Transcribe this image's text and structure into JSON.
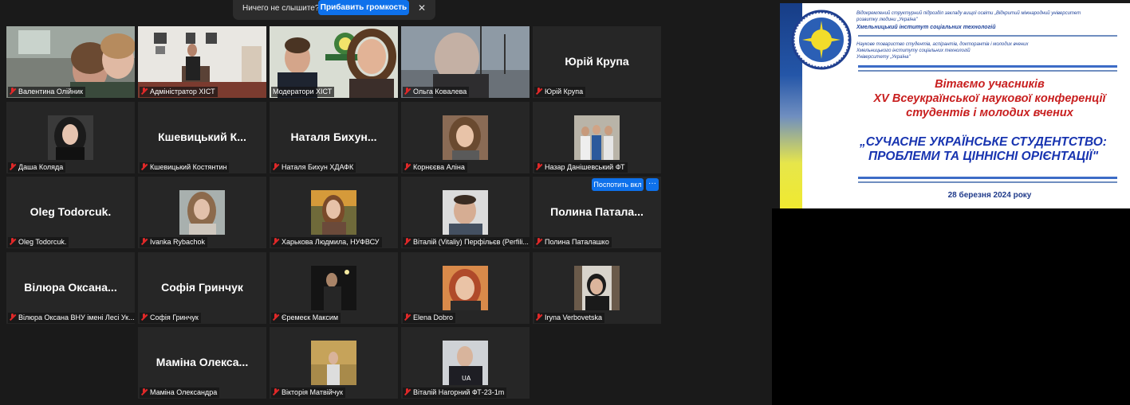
{
  "notification": {
    "text": "Ничего не слышите?",
    "button": "Прибавить громкость",
    "close": "✕"
  },
  "grid": {
    "spotlight_button": "Поспотить вкл",
    "more_button": "···"
  },
  "participants": [
    {
      "name": "Валентина Олійник",
      "display": "",
      "muted": true
    },
    {
      "name": "Адміністратор ХІСТ",
      "display": "",
      "muted": true
    },
    {
      "name": "Модератори ХІСТ",
      "display": "",
      "muted": false,
      "active": true
    },
    {
      "name": "Ольга Ковалева",
      "display": "",
      "muted": true
    },
    {
      "name": "Юрій Крупа",
      "display": "Юрій Крупа",
      "muted": true
    },
    {
      "name": "Даша Коляда",
      "display": "",
      "muted": true
    },
    {
      "name": "Кшевицький Костянтин",
      "display": "Кшевицький К...",
      "muted": true
    },
    {
      "name": "Наталя Бихун ХДАФК",
      "display": "Наталя Бихун...",
      "muted": true
    },
    {
      "name": "Корнєєва Аліна",
      "display": "",
      "muted": true
    },
    {
      "name": "Назар Данішевський ФТ",
      "display": "",
      "muted": true
    },
    {
      "name": "Oleg Todorcuk.",
      "display": "Oleg Todorcuk.",
      "muted": true
    },
    {
      "name": "Ivanka Rybachok",
      "display": "",
      "muted": true
    },
    {
      "name": "Харькова Людмила, НУФВСУ",
      "display": "",
      "muted": true
    },
    {
      "name": "Віталій (Vitaliy) Перфільєв (Perfili...",
      "display": "",
      "muted": true
    },
    {
      "name": "Полина Паталашко",
      "display": "Полина Патала...",
      "muted": true
    },
    {
      "name": "Вілюра Оксана ВНУ імені Лесі Ук...",
      "display": "Вілюра Оксана...",
      "muted": true
    },
    {
      "name": "Софія Гринчук",
      "display": "Софія Гринчук",
      "muted": true
    },
    {
      "name": "Єремеєк Максим",
      "display": "",
      "muted": true
    },
    {
      "name": "Elena Dobro",
      "display": "",
      "muted": true
    },
    {
      "name": "Iryna Verbovetska",
      "display": "",
      "muted": true
    },
    {
      "name": "Маміна Олександра",
      "display": "Маміна Олекса...",
      "muted": true
    },
    {
      "name": "Вікторія Матвійчук",
      "display": "",
      "muted": true
    },
    {
      "name": "Віталій Нагорний ФТ-23-1m",
      "display": "",
      "muted": true
    }
  ],
  "slide": {
    "header_1": "Відокремлений структурний підрозділ закладу вищої освіти „Відкритий міжнародний університет",
    "header_2": "розвитку людини „Україна\"",
    "header_3": "Хмельницький інститут соціальних технологій",
    "header_4": "Наукове товариство студентів, аспірантів, докторантів і молодих вчених",
    "header_5": "Хмельницького інституту соціальних технологій",
    "header_6": "Університету „Україна\"",
    "greeting_1": "Вітаємо учасників",
    "greeting_2": "XV Всеукраїнської наукової конференції",
    "greeting_3": "студентів і молодих вчених",
    "theme_1": "„СУЧАСНЕ УКРАЇНСЬКЕ СТУДЕНТСТВО:",
    "theme_2": "ПРОБЛЕМИ ТА ЦІННІСНІ ОРІЄНТАЦІЇ\"",
    "date": "28 березня 2024 року"
  },
  "colors": {
    "zoom_blue": "#0e71eb",
    "active_speaker": "#d8e05a",
    "muted_red": "#e02828",
    "slide_red": "#c81f1f",
    "slide_blue": "#1834b0"
  }
}
